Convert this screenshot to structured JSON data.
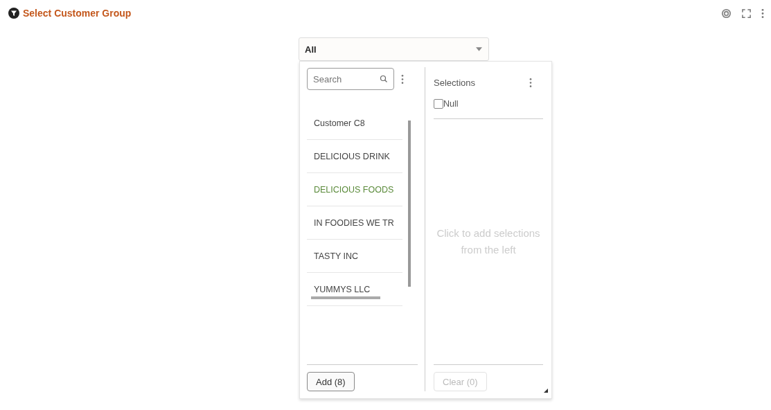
{
  "header": {
    "title": "Select Customer Group"
  },
  "dropdown": {
    "value": "All"
  },
  "search": {
    "placeholder": "Search"
  },
  "list": [
    {
      "label": "Customer C8",
      "highlighted": false
    },
    {
      "label": "DELICIOUS DRINK",
      "highlighted": false
    },
    {
      "label": "DELICIOUS FOODS",
      "highlighted": true
    },
    {
      "label": "IN FOODIES WE TR",
      "highlighted": false
    },
    {
      "label": "TASTY INC",
      "highlighted": false
    },
    {
      "label": "YUMMYS LLC",
      "highlighted": false
    }
  ],
  "selections": {
    "title": "Selections",
    "null_option": {
      "label": "Null",
      "checked": false
    },
    "empty_hint": "Click to add selections from the left"
  },
  "buttons": [
    {
      "label": "Add (8)",
      "disabled": false
    },
    {
      "label": "Clear (0)",
      "disabled": true
    }
  ]
}
